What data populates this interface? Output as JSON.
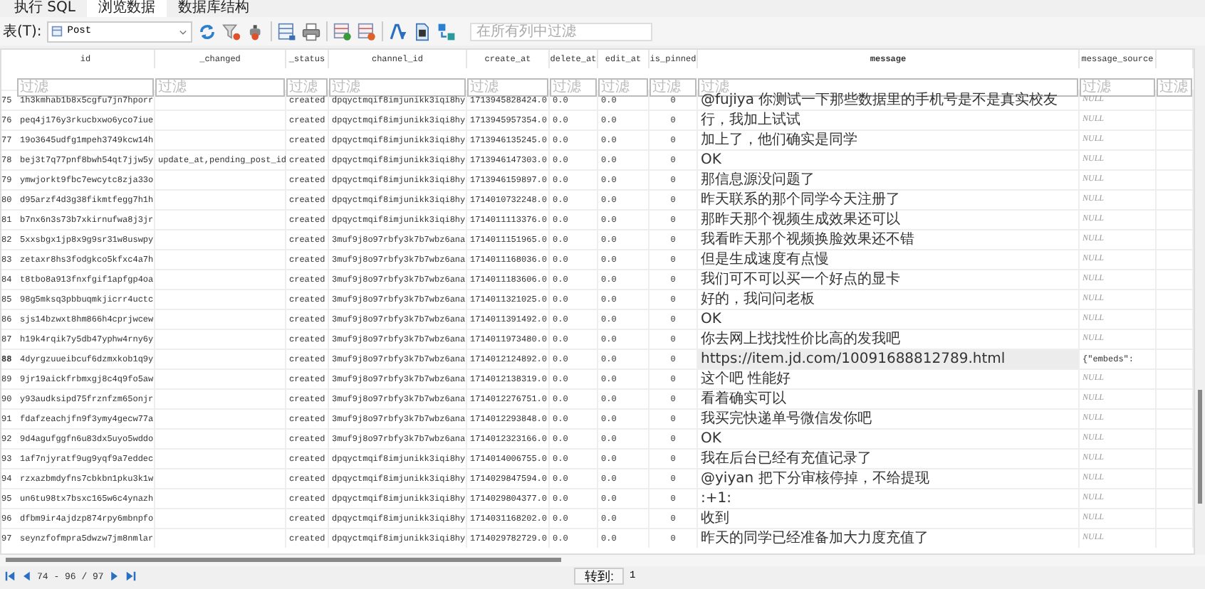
{
  "tabs": [
    {
      "label": "执行 SQL",
      "selected": false
    },
    {
      "label": "浏览数据",
      "selected": true
    },
    {
      "label": "数据库结构",
      "selected": false
    }
  ],
  "toolbar": {
    "table_label": "表(T):",
    "table_value": "Post",
    "filter_placeholder": "在所有列中过滤"
  },
  "table": {
    "columns": [
      {
        "name": "id",
        "sorted": false,
        "placeholder": "过滤"
      },
      {
        "name": "_changed",
        "sorted": false,
        "placeholder": "过滤"
      },
      {
        "name": "_status",
        "sorted": false,
        "placeholder": "过滤"
      },
      {
        "name": "channel_id",
        "sorted": false,
        "placeholder": "过滤"
      },
      {
        "name": "create_at",
        "sorted": false,
        "placeholder": "过滤"
      },
      {
        "name": "delete_at",
        "sorted": false,
        "placeholder": "过滤"
      },
      {
        "name": "edit_at",
        "sorted": false,
        "placeholder": "过滤"
      },
      {
        "name": "is_pinned",
        "sorted": false,
        "placeholder": "过滤"
      },
      {
        "name": "message",
        "sorted": true,
        "placeholder": "过滤"
      },
      {
        "name": "message_source",
        "sorted": false,
        "placeholder": "过滤"
      },
      {
        "placeholder": "过滤"
      }
    ],
    "rows": [
      {
        "num": "75",
        "cells": [
          "1h3kmhab1b8x5cgfu7jn7hporr",
          "",
          "created",
          "dpqyctmqif8imjunikk3iqi8hy",
          "1713945828424.0",
          "0.0",
          "0.0",
          "0",
          "@fujiya 你测试一下那些数据里的手机号是不是真实校友",
          "NULL",
          ""
        ],
        "null_source": true,
        "current": false
      },
      {
        "num": "76",
        "cells": [
          "peq4j176y3rkucbxwo6yco7iue",
          "",
          "created",
          "dpqyctmqif8imjunikk3iqi8hy",
          "1713945957354.0",
          "0.0",
          "0.0",
          "0",
          "行，我加上试试",
          "NULL",
          ""
        ],
        "null_source": true,
        "current": false
      },
      {
        "num": "77",
        "cells": [
          "19o3645udfg1mpeh3749kcw14h",
          "",
          "created",
          "dpqyctmqif8imjunikk3iqi8hy",
          "1713946135245.0",
          "0.0",
          "0.0",
          "0",
          "加上了，他们确实是同学",
          "NULL",
          ""
        ],
        "null_source": true,
        "current": false
      },
      {
        "num": "78",
        "cells": [
          "bej3t7q77pnf8bwh54qt7jjw5y",
          "update_at,pending_post_id",
          "created",
          "dpqyctmqif8imjunikk3iqi8hy",
          "1713946147303.0",
          "0.0",
          "0.0",
          "0",
          "OK",
          "NULL",
          ""
        ],
        "null_source": true,
        "current": false
      },
      {
        "num": "79",
        "cells": [
          "ymwjorkt9fbc7ewcytc8zja33o",
          "",
          "created",
          "dpqyctmqif8imjunikk3iqi8hy",
          "1713946159897.0",
          "0.0",
          "0.0",
          "0",
          "那信息源没问题了",
          "NULL",
          ""
        ],
        "null_source": true,
        "current": false
      },
      {
        "num": "80",
        "cells": [
          "d95arzf4d3g38fikmtfegg7h1h",
          "",
          "created",
          "dpqyctmqif8imjunikk3iqi8hy",
          "1714010732248.0",
          "0.0",
          "0.0",
          "0",
          "昨天联系的那个同学今天注册了",
          "NULL",
          ""
        ],
        "null_source": true,
        "current": false
      },
      {
        "num": "81",
        "cells": [
          "b7nx6n3s73b7xkirnufwa8j3jr",
          "",
          "created",
          "dpqyctmqif8imjunikk3iqi8hy",
          "1714011113376.0",
          "0.0",
          "0.0",
          "0",
          "那昨天那个视频生成效果还可以",
          "NULL",
          ""
        ],
        "null_source": true,
        "current": false
      },
      {
        "num": "82",
        "cells": [
          "5xxsbgx1jp8x9g9sr31w8uswpy",
          "",
          "created",
          "3muf9j8o97rbfy3k7b7wbz6ana",
          "1714011151965.0",
          "0.0",
          "0.0",
          "0",
          "我看昨天那个视频换脸效果还不错",
          "NULL",
          ""
        ],
        "null_source": true,
        "current": false
      },
      {
        "num": "83",
        "cells": [
          "zetaxr8hs3fodgkco5kfxc4a7h",
          "",
          "created",
          "3muf9j8o97rbfy3k7b7wbz6ana",
          "1714011168036.0",
          "0.0",
          "0.0",
          "0",
          "但是生成速度有点慢",
          "NULL",
          ""
        ],
        "null_source": true,
        "current": false
      },
      {
        "num": "84",
        "cells": [
          "t8tbo8a913fnxfgif1apfgp4oa",
          "",
          "created",
          "3muf9j8o97rbfy3k7b7wbz6ana",
          "1714011183606.0",
          "0.0",
          "0.0",
          "0",
          "我们可不可以买一个好点的显卡",
          "NULL",
          ""
        ],
        "null_source": true,
        "current": false
      },
      {
        "num": "85",
        "cells": [
          "98g5mksq3pbbuqmkjicrr4uctc",
          "",
          "created",
          "3muf9j8o97rbfy3k7b7wbz6ana",
          "1714011321025.0",
          "0.0",
          "0.0",
          "0",
          "好的，我问问老板",
          "NULL",
          ""
        ],
        "null_source": true,
        "current": false
      },
      {
        "num": "86",
        "cells": [
          "sjs14bzwxt8hm866h4cprjwcew",
          "",
          "created",
          "3muf9j8o97rbfy3k7b7wbz6ana",
          "1714011391492.0",
          "0.0",
          "0.0",
          "0",
          "OK",
          "NULL",
          ""
        ],
        "null_source": true,
        "current": false
      },
      {
        "num": "87",
        "cells": [
          "h19k4rqik7y5db47yphw4rny6y",
          "",
          "created",
          "3muf9j8o97rbfy3k7b7wbz6ana",
          "1714011973480.0",
          "0.0",
          "0.0",
          "0",
          "你去网上找找性价比高的发我吧",
          "NULL",
          ""
        ],
        "null_source": true,
        "current": false
      },
      {
        "num": "88",
        "cells": [
          "4dyrgzuueibcuf6dzmxkob1q9y",
          "",
          "created",
          "3muf9j8o97rbfy3k7b7wbz6ana",
          "1714012124892.0",
          "0.0",
          "0.0",
          "0",
          "https://item.jd.com/10091688812789.html",
          "{\"embeds\":",
          ""
        ],
        "null_source": false,
        "current": true
      },
      {
        "num": "89",
        "cells": [
          "9jr19aickfrbmxgj8c4q9fo5aw",
          "",
          "created",
          "3muf9j8o97rbfy3k7b7wbz6ana",
          "1714012138319.0",
          "0.0",
          "0.0",
          "0",
          "这个吧 性能好",
          "NULL",
          ""
        ],
        "null_source": true,
        "current": false
      },
      {
        "num": "90",
        "cells": [
          "y93audksipd75frznfzm65onjr",
          "",
          "created",
          "3muf9j8o97rbfy3k7b7wbz6ana",
          "1714012276751.0",
          "0.0",
          "0.0",
          "0",
          "看着确实可以",
          "NULL",
          ""
        ],
        "null_source": true,
        "current": false
      },
      {
        "num": "91",
        "cells": [
          "fdafzeachjfn9f3ymy4gecw77a",
          "",
          "created",
          "3muf9j8o97rbfy3k7b7wbz6ana",
          "1714012293848.0",
          "0.0",
          "0.0",
          "0",
          "我买完快递单号微信发你吧",
          "NULL",
          ""
        ],
        "null_source": true,
        "current": false
      },
      {
        "num": "92",
        "cells": [
          "9d4agufggfn6u83dx5uyo5wddo",
          "",
          "created",
          "3muf9j8o97rbfy3k7b7wbz6ana",
          "1714012323166.0",
          "0.0",
          "0.0",
          "0",
          "OK",
          "NULL",
          ""
        ],
        "null_source": true,
        "current": false
      },
      {
        "num": "93",
        "cells": [
          "1af7njyratf9ug9yqf9a7eddec",
          "",
          "created",
          "dpqyctmqif8imjunikk3iqi8hy",
          "1714014006755.0",
          "0.0",
          "0.0",
          "0",
          "我在后台已经有充值记录了",
          "NULL",
          ""
        ],
        "null_source": true,
        "current": false
      },
      {
        "num": "94",
        "cells": [
          "rzxazbmdyfns7cbkbn1pku3k1w",
          "",
          "created",
          "dpqyctmqif8imjunikk3iqi8hy",
          "1714029847594.0",
          "0.0",
          "0.0",
          "0",
          "@yiyan 把下分审核停掉，不给提现",
          "NULL",
          ""
        ],
        "null_source": true,
        "current": false
      },
      {
        "num": "95",
        "cells": [
          "un6tu98tx7bsxc165w6c4ynazh",
          "",
          "created",
          "dpqyctmqif8imjunikk3iqi8hy",
          "1714029804377.0",
          "0.0",
          "0.0",
          "0",
          ":+1:",
          "NULL",
          ""
        ],
        "null_source": true,
        "current": false
      },
      {
        "num": "96",
        "cells": [
          "dfbm9ir4ajdzp874rpy6mbnpfo",
          "",
          "created",
          "dpqyctmqif8imjunikk3iqi8hy",
          "1714031168202.0",
          "0.0",
          "0.0",
          "0",
          "收到",
          "NULL",
          ""
        ],
        "null_source": true,
        "current": false
      },
      {
        "num": "97",
        "cells": [
          "seynzfofmpra5dwzw7jm8nmlar",
          "",
          "created",
          "dpqyctmqif8imjunikk3iqi8hy",
          "1714029782729.0",
          "0.0",
          "0.0",
          "0",
          "昨天的同学已经准备加大力度充值了",
          "NULL",
          ""
        ],
        "null_source": true,
        "current": false
      }
    ]
  },
  "pager": {
    "range": "74 - 96 / 97",
    "goto_label": "转到:",
    "goto_value": "1"
  }
}
